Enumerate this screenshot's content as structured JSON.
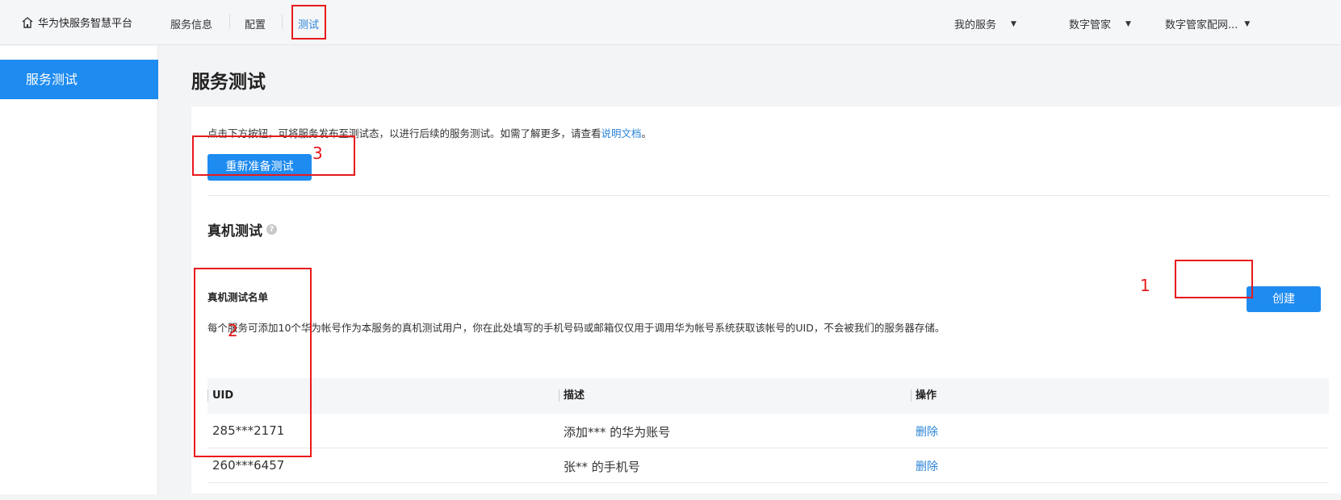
{
  "topbar": {
    "brand": "华为快服务智慧平台",
    "nav": [
      "服务信息",
      "配置",
      "测试"
    ],
    "right": [
      "我的服务",
      "数字管家",
      "数字管家配网..."
    ]
  },
  "sidebar": {
    "items": [
      {
        "label": "服务测试"
      }
    ]
  },
  "page": {
    "title": "服务测试",
    "intro_text": "点击下方按钮，可将服务发布至测试态，以进行后续的服务测试。如需了解更多，请查看",
    "intro_link": "说明文档",
    "intro_end": "。",
    "reprepare_button": "重新准备测试",
    "section_title": "真机测试",
    "list_title": "真机测试名单",
    "list_desc": "每个服务可添加10个华为帐号作为本服务的真机测试用户，你在此处填写的手机号码或邮箱仅仅用于调用华为帐号系统获取该帐号的UID，不会被我们的服务器存储。",
    "create_button": "创建"
  },
  "table": {
    "headers": [
      "UID",
      "描述",
      "操作"
    ],
    "rows": [
      {
        "uid": "285***2171",
        "desc": "添加*** 的华为账号",
        "action": "删除"
      },
      {
        "uid": "260***6457",
        "desc": "张** 的手机号",
        "action": "删除"
      }
    ]
  },
  "annotations": [
    "1",
    "2",
    "3"
  ],
  "colors": {
    "accent": "#1e8bf0",
    "link": "#2a84d8",
    "annotation": "#e8191c"
  }
}
